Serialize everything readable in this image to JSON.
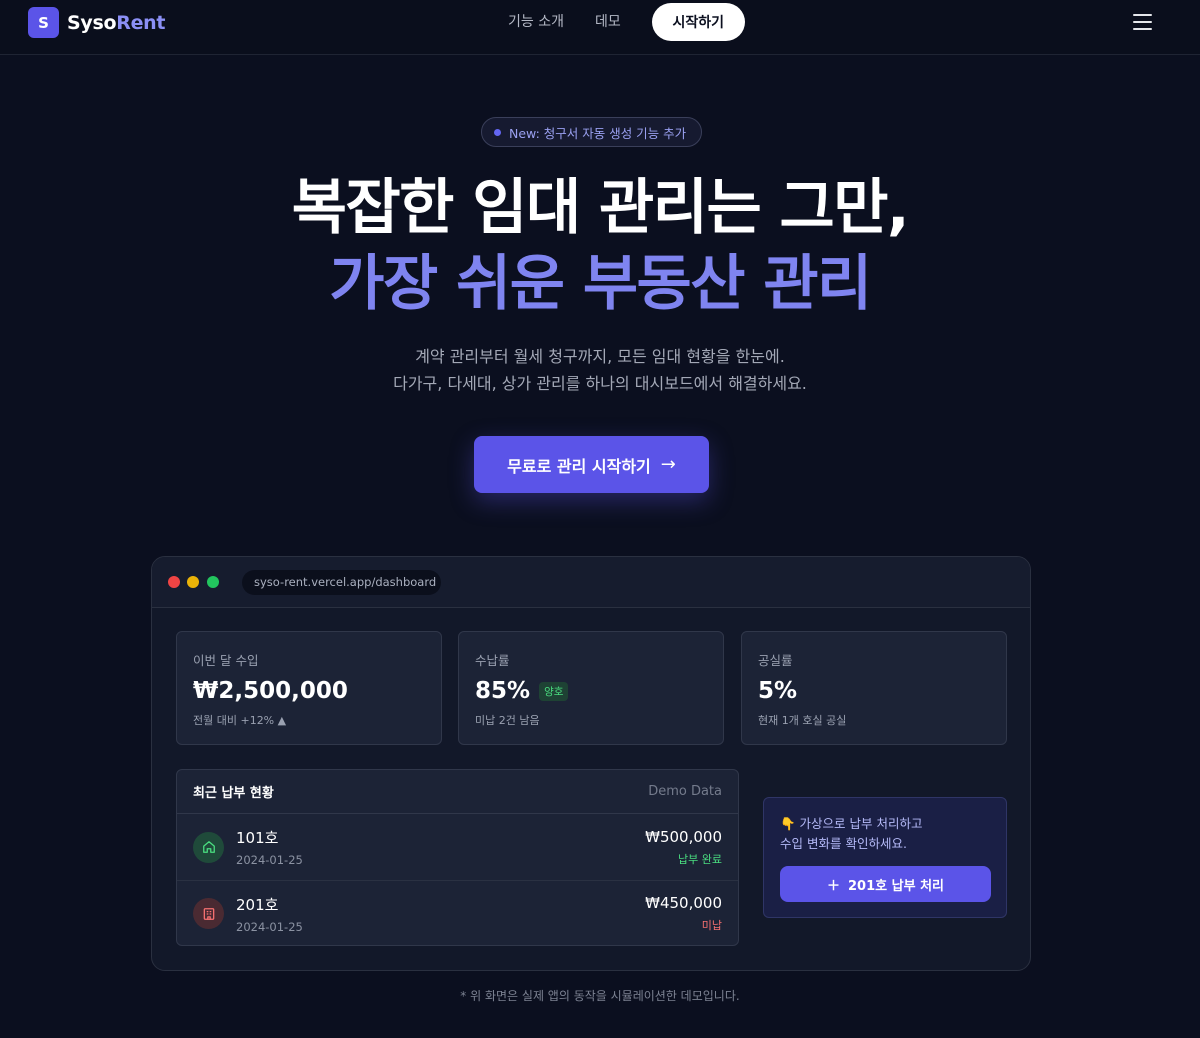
{
  "nav": {
    "logo_mark": "S",
    "logo_primary": "Syso",
    "logo_accent": "Rent",
    "links": [
      "기능 소개",
      "데모"
    ],
    "cta": "시작하기"
  },
  "hero": {
    "badge": "New: 청구서 자동 생성 기능 추가",
    "title_line1": "복잡한 임대 관리는 그만,",
    "title_line2": "가장 쉬운 부동산 관리",
    "subtitle_line1": "계약 관리부터 월세 청구까지, 모든 임대 현황을 한눈에.",
    "subtitle_line2": "다가구, 다세대, 상가 관리를 하나의 대시보드에서 해결하세요.",
    "cta": "무료로 관리 시작하기"
  },
  "dashboard": {
    "url": "syso-rent.vercel.app/dashboard",
    "stats": [
      {
        "label": "이번 달 수입",
        "value": "₩2,500,000",
        "note": "전월 대비 +12% ▲"
      },
      {
        "label": "수납률",
        "value": "85%",
        "badge": "양호",
        "note": "미납 2건 남음"
      },
      {
        "label": "공실률",
        "value": "5%",
        "note": "현재 1개 호실 공실"
      }
    ],
    "list": {
      "title": "최근 납부 현황",
      "meta": "Demo Data",
      "rows": [
        {
          "name": "101호",
          "date": "2024-01-25",
          "amount": "₩500,000",
          "status": "납부 완료",
          "icon": "home-icon"
        },
        {
          "name": "201호",
          "date": "2024-01-25",
          "amount": "₩450,000",
          "status": "미납",
          "icon": "building-icon"
        }
      ]
    },
    "simulation": {
      "line1": "👇 가상으로 납부 처리하고",
      "line2": "수입 변화를 확인하세요.",
      "button": "201호 납부 처리"
    }
  },
  "footnote": "* 위 화면은 실제 앱의 동작을 시뮬레이션한 데모입니다.",
  "colors": {
    "background": "#0b0f1f",
    "accent": "#5b54e8",
    "accent_text": "#7f84f0",
    "success": "#4ade80",
    "danger": "#f87171"
  }
}
